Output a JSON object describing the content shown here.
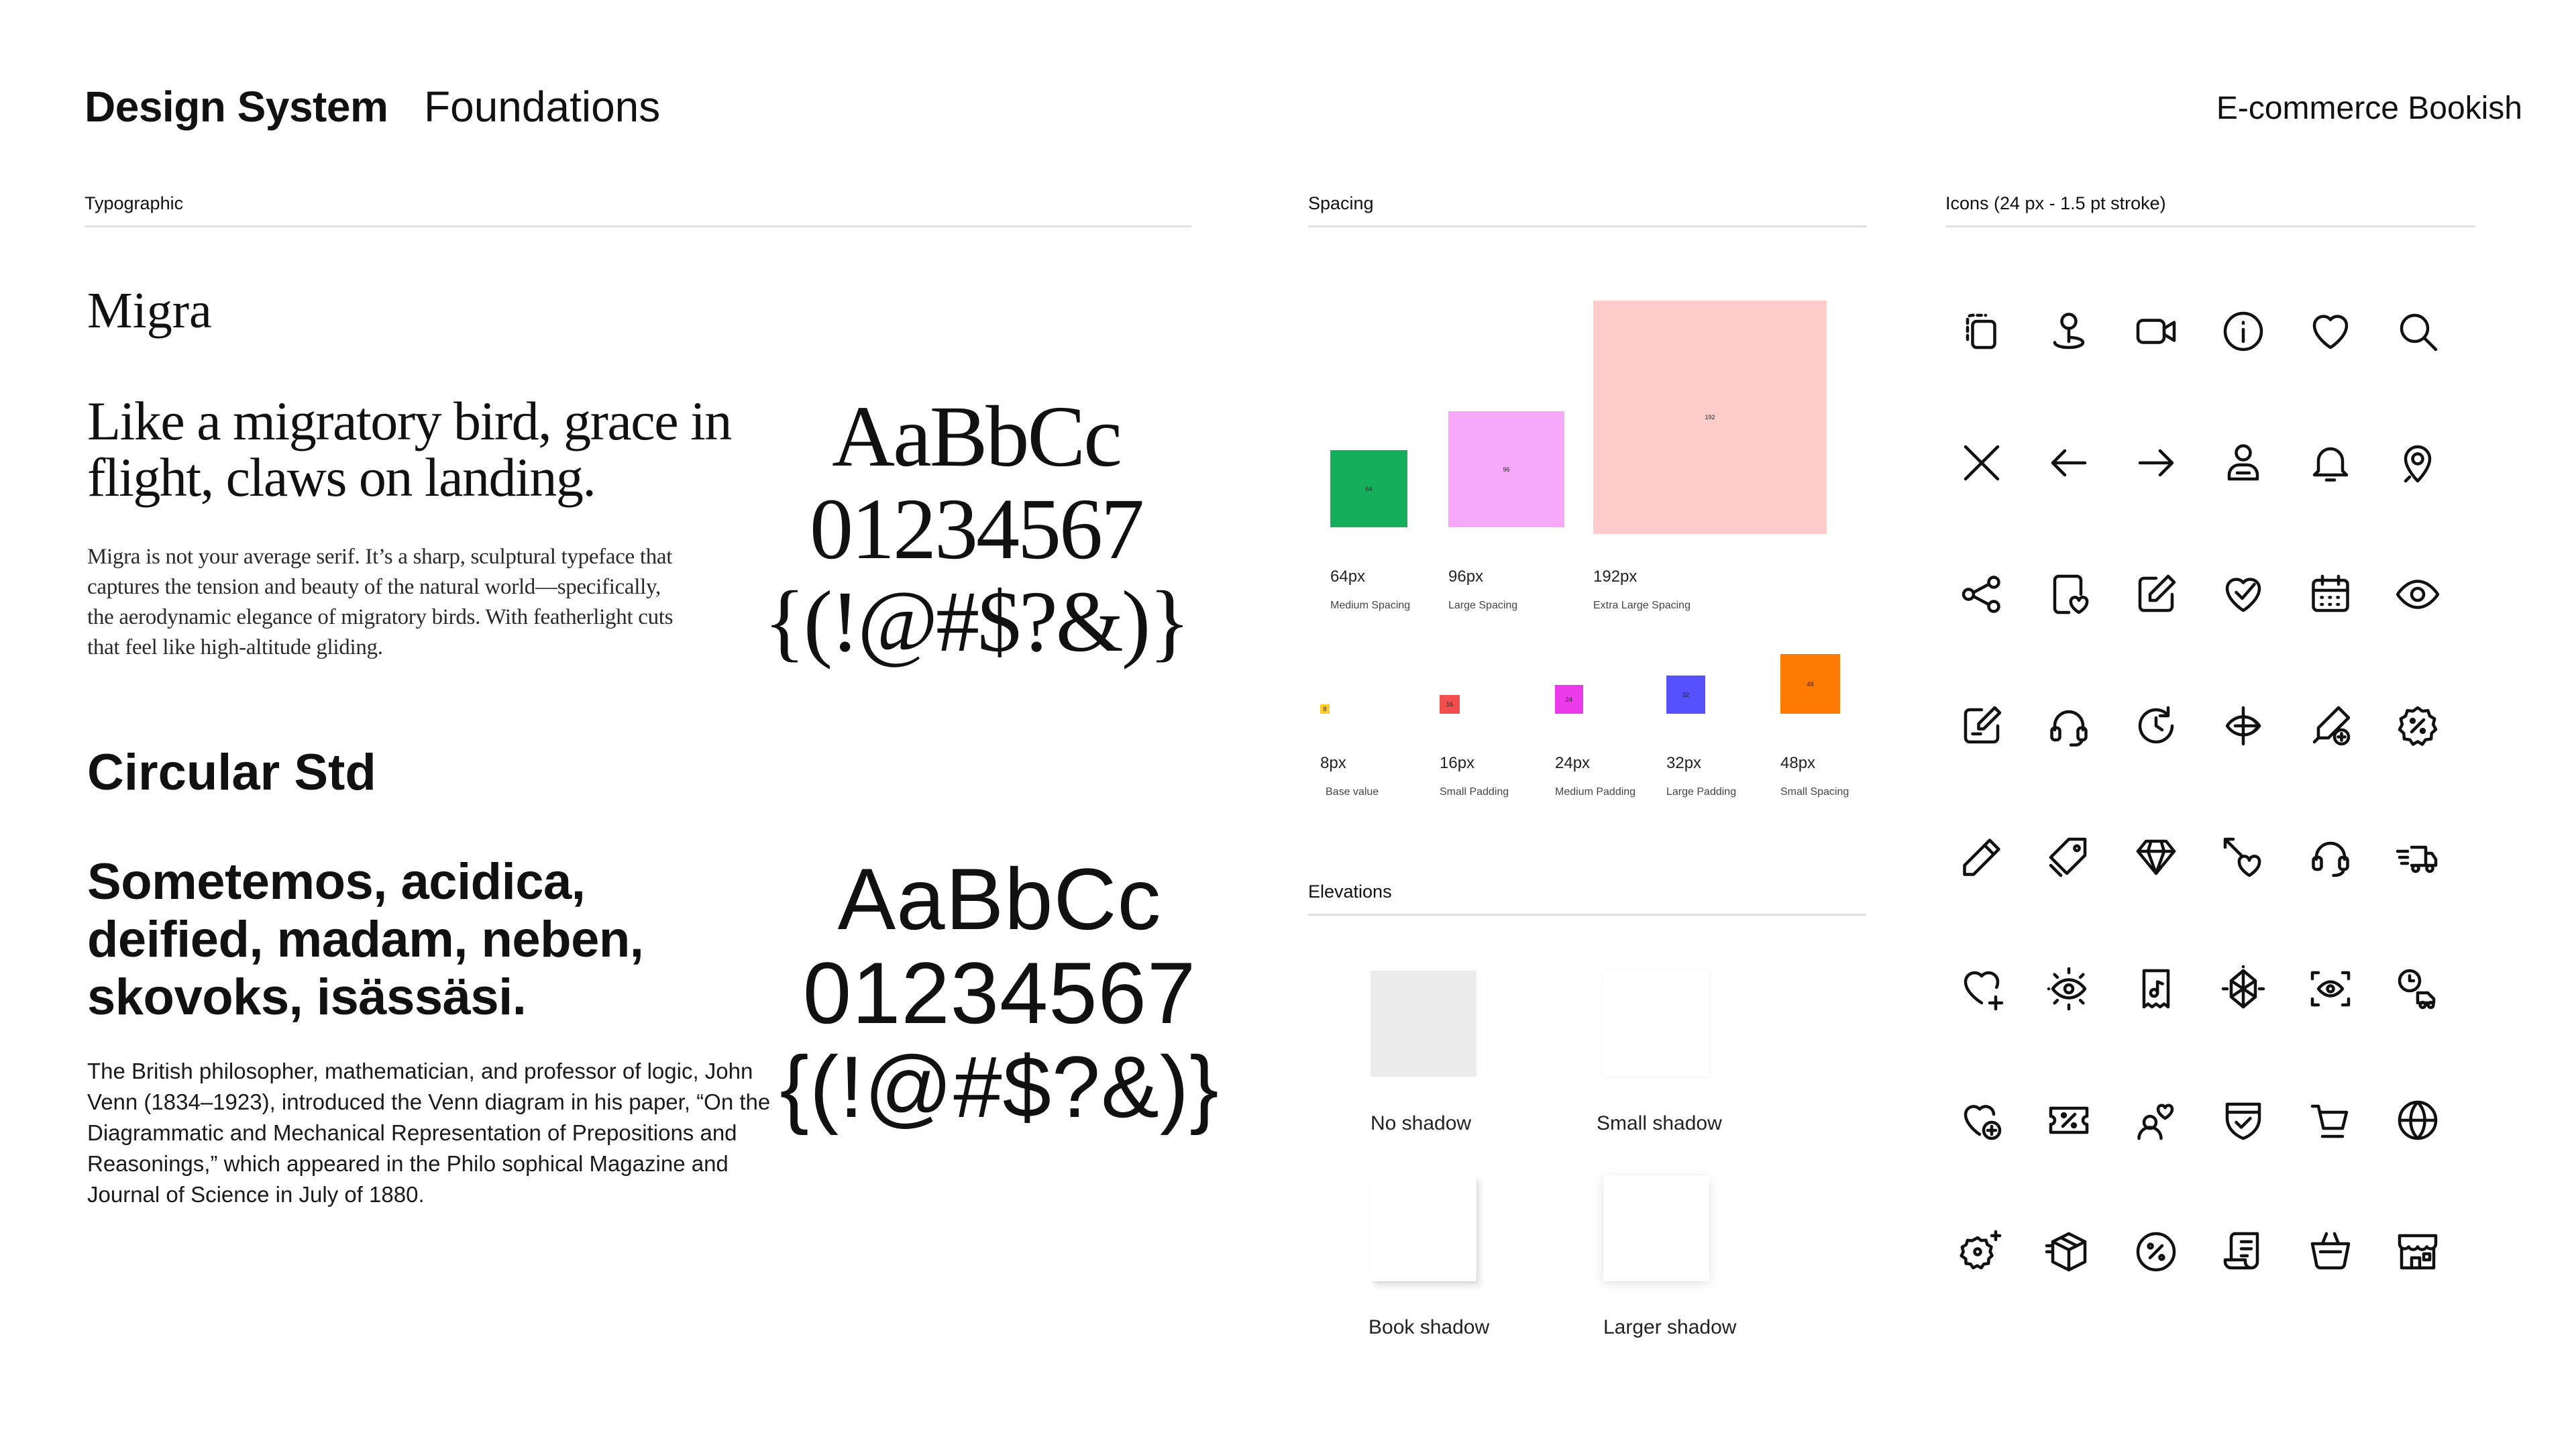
{
  "header": {
    "title": "Design System",
    "subtitle": "Foundations",
    "project": "E-commerce Bookish"
  },
  "sections": {
    "typographic": "Typographic",
    "spacing": "Spacing",
    "icons": "Icons (24 px - 1.5 pt stroke)",
    "elevations": "Elevations"
  },
  "typography": {
    "serif": {
      "name": "Migra",
      "headline": "Like a migratory bird, grace in flight, claws on landing.",
      "body": "Migra is not your average serif. It’s a sharp, sculptural typeface that captures the tension and beauty of the natural world—specifically, the aerodynamic elegance of migratory birds. With featherlight cuts that feel like high-altitude gliding.",
      "specimen_line1": "AaBbCc",
      "specimen_line2": "01234567",
      "specimen_line3": "{(!@#$?&)}"
    },
    "sans": {
      "name": "Circular Std",
      "headline": "Sometemos, acidica, deified, madam, neben, skovoks, isässäsi.",
      "body": "The British philosopher, mathematician, and professor of logic, John Venn (1834–1923), introduced the Venn diagram in his paper, “On the Diagrammatic and Mechanical Representation of Prepositions and Reasonings,” which appeared in the Philo sophical Magazine and Journal of Science in July of 1880.",
      "specimen_line1": "AaBbCc",
      "specimen_line2": "01234567",
      "specimen_line3": "{(!@#$?&)}"
    }
  },
  "spacing": {
    "large": [
      {
        "value": "64",
        "label": "64px",
        "desc": "Medium Spacing",
        "color": "#14AE5C"
      },
      {
        "value": "96",
        "label": "96px",
        "desc": "Large Spacing",
        "color": "#F6A8F9"
      },
      {
        "value": "192",
        "label": "192px",
        "desc": "Extra Large Spacing",
        "color": "#FFCCCC"
      }
    ],
    "small": [
      {
        "value": "8",
        "label": "8px",
        "desc": "Base value",
        "color": "#FFCD29"
      },
      {
        "value": "16",
        "label": "16px",
        "desc": "Small Padding",
        "color": "#F24E4E"
      },
      {
        "value": "24",
        "label": "24px",
        "desc": "Medium Padding",
        "color": "#EA3AEA"
      },
      {
        "value": "32",
        "label": "32px",
        "desc": "Large Padding",
        "color": "#5551FF"
      },
      {
        "value": "48",
        "label": "48px",
        "desc": "Small Spacing",
        "color": "#FF7A00"
      }
    ]
  },
  "elevations": [
    {
      "label": "No shadow",
      "fill": "#ECECEC"
    },
    {
      "label": "Small shadow",
      "fill": "#FFFFFF"
    },
    {
      "label": "Book shadow",
      "fill": "#FFFFFF"
    },
    {
      "label": "Larger shadow",
      "fill": "#FFFFFF"
    }
  ],
  "icons": [
    [
      "copy-icon",
      "location-pin-icon",
      "video-camera-icon",
      "info-icon",
      "heart-icon",
      "search-icon"
    ],
    [
      "close-icon",
      "arrow-left-icon",
      "arrow-right-icon",
      "user-icon",
      "bell-icon",
      "location-icon"
    ],
    [
      "share-icon",
      "favorite-book-icon",
      "edit-icon",
      "heart-check-icon",
      "calendar-icon",
      "eye-icon"
    ],
    [
      "note-edit-icon",
      "headset-icon",
      "refresh-time-icon",
      "compass-icon",
      "pen-add-icon",
      "discount-badge-icon"
    ],
    [
      "pencil-icon",
      "tag-icon",
      "diamond-icon",
      "arrow-heart-icon",
      "support-icon",
      "fast-delivery-icon"
    ],
    [
      "heart-add-icon",
      "view-icon",
      "bookmark-music-icon",
      "crystal-icon",
      "scan-eye-icon",
      "scheduled-delivery-icon"
    ],
    [
      "heart-plus-icon",
      "coupon-icon",
      "romance-icon",
      "shield-check-icon",
      "cart-icon",
      "globe-icon"
    ],
    [
      "sparkle-badge-icon",
      "box-3d-icon",
      "percent-icon",
      "receipt-icon",
      "basket-icon",
      "store-icon"
    ]
  ]
}
